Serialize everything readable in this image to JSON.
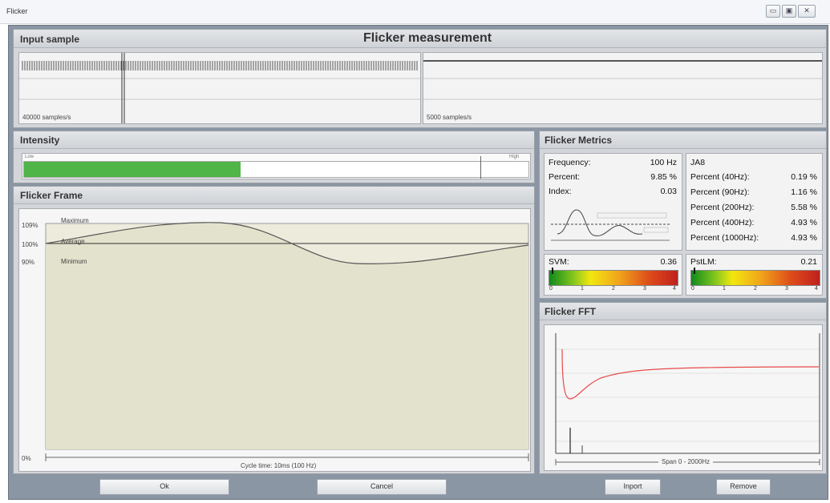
{
  "window": {
    "title": "Flicker",
    "controls": [
      "minimize",
      "maximize",
      "close"
    ]
  },
  "header": {
    "title": "Flicker measurement"
  },
  "input_sample": {
    "title": "Input sample",
    "left_rate": "40000 samples/s",
    "right_rate": "5000 samples/s"
  },
  "intensity": {
    "title": "Intensity",
    "low_label": "Low",
    "high_label": "High",
    "level": 0.43,
    "bar_color": "#4fb548"
  },
  "flicker_frame": {
    "title": "Flicker Frame",
    "y_ticks": [
      "109%",
      "100%",
      "90%",
      "0%"
    ],
    "labels": {
      "maximum": "Maximum",
      "average": "Average",
      "minimum": "Minimum"
    },
    "x_caption": "Cycle time: 10ms (100 Hz)",
    "background": "#ecebdc"
  },
  "metrics": {
    "title": "Flicker Metrics",
    "frequency": {
      "label": "Frequency:",
      "value": "100 Hz"
    },
    "percent": {
      "label": "Percent:",
      "value": "9.85 %"
    },
    "index": {
      "label": "Index:",
      "value": "0.03"
    },
    "ja8": {
      "title": "JA8",
      "rows": [
        {
          "label": "Percent (40Hz):",
          "value": "0.19 %"
        },
        {
          "label": "Percent (90Hz):",
          "value": "1.16 %"
        },
        {
          "label": "Percent (200Hz):",
          "value": "5.58 %"
        },
        {
          "label": "Percent (400Hz):",
          "value": "4.93 %"
        },
        {
          "label": "Percent (1000Hz):",
          "value": "4.93 %"
        }
      ]
    },
    "svm": {
      "label": "SVM:",
      "value": "0.36",
      "ticks": [
        "0",
        "1",
        "2",
        "3",
        "4"
      ]
    },
    "pstlm": {
      "label": "PstLM:",
      "value": "0.21",
      "ticks": [
        "0",
        "1",
        "2",
        "3",
        "4"
      ]
    }
  },
  "fft": {
    "title": "Flicker FFT",
    "x_caption": "Span 0 - 2000Hz",
    "curve_color": "#e84a4a"
  },
  "buttons": {
    "ok": "Ok",
    "cancel": "Cancel",
    "import": "Inport",
    "remove": "Remove"
  }
}
